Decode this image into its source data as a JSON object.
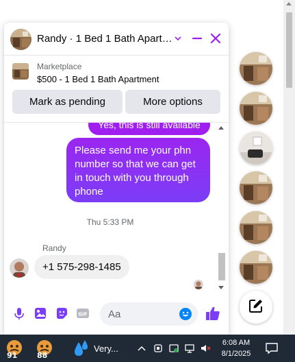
{
  "chat": {
    "title": "Randy · 1 Bed 1 Bath Apart…",
    "marketplace_label": "Marketplace",
    "listing": "$500 - 1 Bed 1 Bath Apartment",
    "mark_pending_label": "Mark as pending",
    "more_options_label": "More options"
  },
  "messages": {
    "prev_outgoing": "Yes, this is still available",
    "outgoing": "Please send me your phn number so that we can get in touch with you through phone",
    "timestamp": "Thu 5:33 PM",
    "sender_name": "Randy",
    "incoming": "+1 575-298-1485"
  },
  "composer": {
    "placeholder": "Aa"
  },
  "taskbar": {
    "badge_1": "91",
    "badge_2": "88",
    "weather_text": "Very...",
    "time": "6:08 AM",
    "date": "8/1/2025"
  },
  "colors": {
    "accent": "#a11ef0",
    "messenger_blue": "#0084ff",
    "taskbar": "#1f2a36"
  },
  "icons": [
    "chevron-down-icon",
    "minimize-icon",
    "close-icon",
    "mic-icon",
    "image-icon",
    "sticker-icon",
    "gif-icon",
    "emoji-icon",
    "like-icon",
    "compose-icon",
    "notification-icon"
  ]
}
